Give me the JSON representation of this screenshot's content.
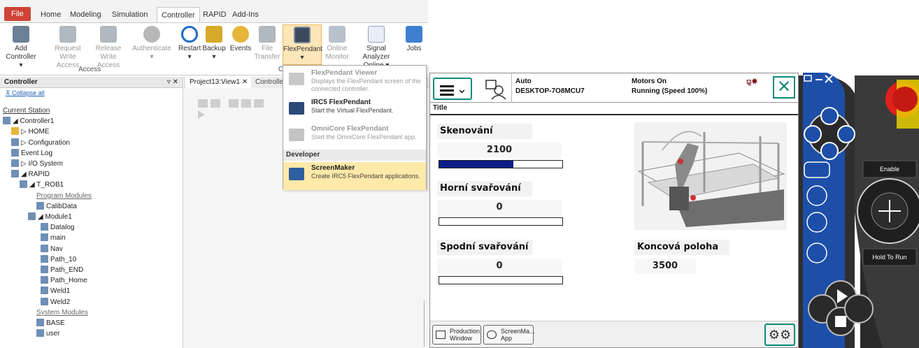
{
  "ribbon": {
    "tabs": [
      "File",
      "Home",
      "Modeling",
      "Simulation",
      "Controller",
      "RAPID",
      "Add-Ins"
    ],
    "active_tab": "Controller",
    "buttons": [
      {
        "label": "Add\nController ▾",
        "icon": "add-controller-icon"
      },
      {
        "label": "Request\nWrite Access",
        "icon": "request-write-icon"
      },
      {
        "label": "Release\nWrite Access",
        "icon": "release-write-icon"
      },
      {
        "label": "Authenticate\n▾",
        "icon": "authenticate-icon"
      },
      {
        "label": "Restart\n▾",
        "icon": "restart-icon"
      },
      {
        "label": "Backup\n▾",
        "icon": "backup-icon"
      },
      {
        "label": "Events",
        "icon": "events-icon"
      },
      {
        "label": "File\nTransfer",
        "icon": "file-transfer-icon"
      },
      {
        "label": "FlexPendant\n▾",
        "icon": "flexpendant-icon"
      },
      {
        "label": "Online\nMonitor",
        "icon": "online-monitor-icon"
      },
      {
        "label": "Signal Analyzer\nOnline ▾",
        "icon": "signal-analyzer-icon"
      },
      {
        "label": "Jobs",
        "icon": "jobs-icon"
      }
    ],
    "group_access": "Access",
    "group_c": "C"
  },
  "controller_panel": {
    "title": "Controller",
    "pin": "▿ ✕",
    "collapse": "⊼ Collapse all",
    "items": [
      {
        "text": "Current Station",
        "kind": "link"
      },
      {
        "text": "◢ Controller1",
        "kind": "node"
      },
      {
        "text": "▷ HOME",
        "kind": "node"
      },
      {
        "text": "▷ Configuration",
        "kind": "node"
      },
      {
        "text": "Event Log",
        "kind": "node"
      },
      {
        "text": "▷ I/O System",
        "kind": "node"
      },
      {
        "text": "◢ RAPID",
        "kind": "node"
      },
      {
        "text": "◢ T_ROB1",
        "kind": "node"
      },
      {
        "text": "Program Modules",
        "kind": "sub"
      },
      {
        "text": "CalibData",
        "kind": "node"
      },
      {
        "text": "◢ Module1",
        "kind": "node"
      },
      {
        "text": "Datalog",
        "kind": "node"
      },
      {
        "text": "main",
        "kind": "node"
      },
      {
        "text": "Nav",
        "kind": "node"
      },
      {
        "text": "Path_10",
        "kind": "node"
      },
      {
        "text": "Path_END",
        "kind": "node"
      },
      {
        "text": "Path_Home",
        "kind": "node"
      },
      {
        "text": "Weld1",
        "kind": "node"
      },
      {
        "text": "Weld2",
        "kind": "node"
      },
      {
        "text": "System Modules",
        "kind": "sub"
      },
      {
        "text": "BASE",
        "kind": "node"
      },
      {
        "text": "user",
        "kind": "node"
      }
    ]
  },
  "doc_tabs": [
    {
      "label": "Project13:View1  ✕",
      "active": true
    },
    {
      "label": "Controller",
      "active": false
    }
  ],
  "dropdown": {
    "items": [
      {
        "title": "FlexPendant Viewer",
        "desc": "Displays the FlexPendant screen of the connected controller.",
        "disabled": true
      },
      {
        "title": "IRC5 FlexPendant",
        "desc": "Start the Virtual FlexPendant.",
        "disabled": false
      },
      {
        "title": "OmniCore FlexPendant",
        "desc": "Start the OmniCore FlexPendant app.",
        "disabled": true
      }
    ],
    "section": "Developer",
    "developer_item": {
      "title": "ScreenMaker",
      "desc": "Create IRC5 FlexPendant applications."
    }
  },
  "flexpendant": {
    "mode": "Auto",
    "host": "DESKTOP-7O8MCU7",
    "motors": "Motors On",
    "running": "Running (Speed 100%)",
    "close": "✕",
    "title": "Title",
    "sections": {
      "scan_label": "Skenování",
      "scan_value": "2100",
      "scan_progress": 0.6,
      "upper_label": "Horní svařování",
      "upper_value": "0",
      "upper_progress": 0,
      "lower_label": "Spodní  svařování",
      "lower_value": "0",
      "lower_progress": 0,
      "end_label": "Koncová poloha",
      "end_value": "3500"
    },
    "taskbar": [
      {
        "label": "Production\nWindow"
      },
      {
        "label": "ScreenMa...\nApp"
      }
    ],
    "gear": "⚙⚙"
  },
  "hardware": {
    "enable": "Enable",
    "hold": "Hold To Run"
  },
  "colors": {
    "teal": "#0a8a7a",
    "progress": "#0a1e86",
    "file_tab": "#d04437",
    "pendant_body": "#3a3a3a",
    "pendant_blue": "#1d4fa8",
    "estop": "#e0201a"
  }
}
